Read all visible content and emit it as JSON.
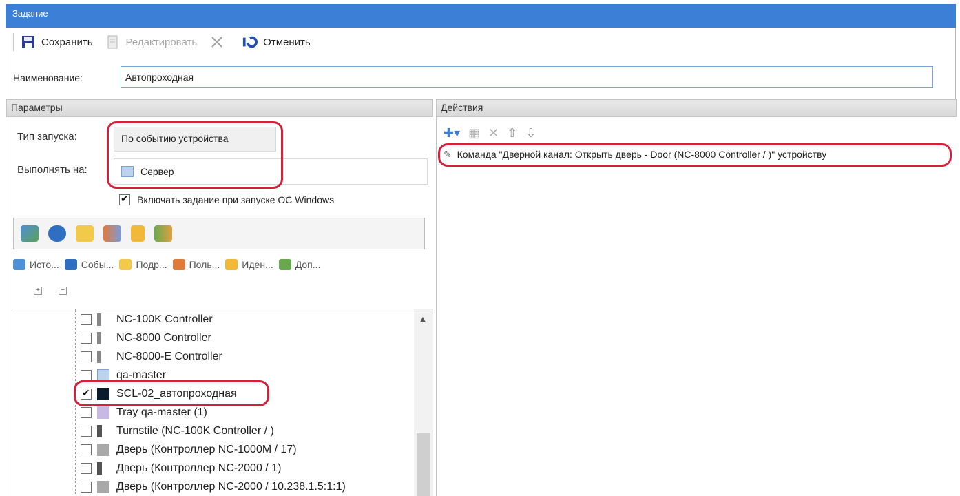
{
  "window": {
    "title": "Задание"
  },
  "toolbar": {
    "save_label": "Сохранить",
    "edit_label": "Редактировать",
    "cancel_label": "Отменить"
  },
  "name_field": {
    "label": "Наименование:",
    "value": "Автопроходная"
  },
  "params": {
    "header": "Параметры",
    "launch_type_label": "Тип запуска:",
    "launch_type_value": "По событию устройства",
    "run_on_label": "Выполнять на:",
    "run_on_value": "Сервер",
    "startup_checkbox_label": "Включать задание при запуске ОС Windows",
    "startup_checked": true
  },
  "tabs": [
    {
      "label": "Исто..."
    },
    {
      "label": "Собы..."
    },
    {
      "label": "Подр..."
    },
    {
      "label": "Поль..."
    },
    {
      "label": "Иден..."
    },
    {
      "label": "Доп..."
    }
  ],
  "tree": [
    {
      "label": "NC-100K Controller",
      "checked": false
    },
    {
      "label": "NC-8000 Controller",
      "checked": false
    },
    {
      "label": "NC-8000-E Controller",
      "checked": false
    },
    {
      "label": "qa-master",
      "checked": false
    },
    {
      "label": "SCL-02_автопроходная",
      "checked": true
    },
    {
      "label": "Tray qa-master (1)",
      "checked": false
    },
    {
      "label": "Turnstile (NC-100K Controller / )",
      "checked": false
    },
    {
      "label": "Дверь (Контроллер NC-1000M / 17)",
      "checked": false
    },
    {
      "label": "Дверь (Контроллер NC-2000 / 1)",
      "checked": false
    },
    {
      "label": "Дверь (Контроллер NC-2000 / 10.238.1.5:1:1)",
      "checked": false
    }
  ],
  "actions": {
    "header": "Действия",
    "items": [
      {
        "label": "Команда \"Дверной канал: Открыть дверь - Door (NC-8000 Controller / )\" устройству"
      }
    ]
  },
  "colors": {
    "titlebar": "#3c7fd6",
    "highlight": "#d3213a"
  }
}
